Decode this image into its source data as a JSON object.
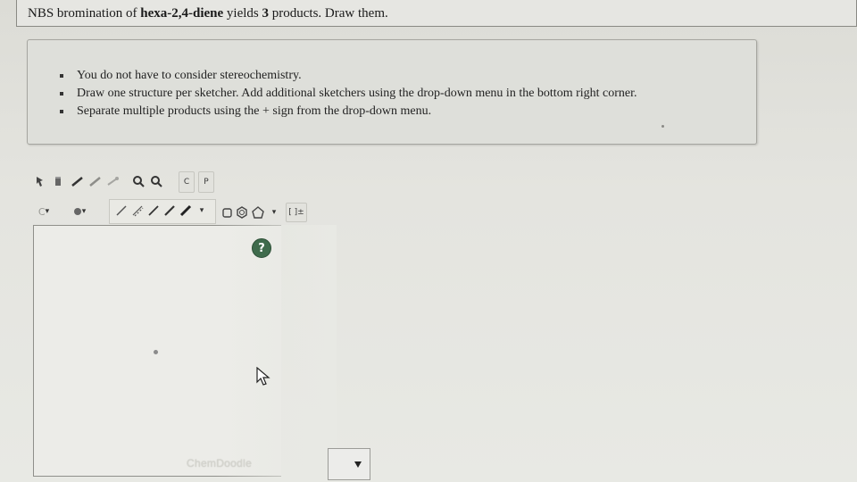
{
  "question": {
    "prefix": "NBS bromination of ",
    "compound": "hexa-2,4-diene",
    "middle": " yields ",
    "count": "3",
    "suffix": " products. Draw them."
  },
  "instructions": [
    "You do not have to consider stereochemistry.",
    "Draw one structure per sketcher. Add additional sketchers using the drop-down menu in the bottom right corner.",
    "Separate multiple products using the + sign from the drop-down menu."
  ],
  "sketcher": {
    "brand": "ChemDoodle",
    "help_label": "?",
    "toolbar_top_text_buttons": [
      "C",
      "P"
    ],
    "element_button": "C",
    "bracket_button": "[ ]±"
  },
  "icons": {
    "help": "question-circle-icon",
    "cursor": "mouse-pointer-icon",
    "dropdown": "triangle-down-icon"
  },
  "colors": {
    "help_bg": "#3f6b4c",
    "border": "#8f8f8a"
  }
}
